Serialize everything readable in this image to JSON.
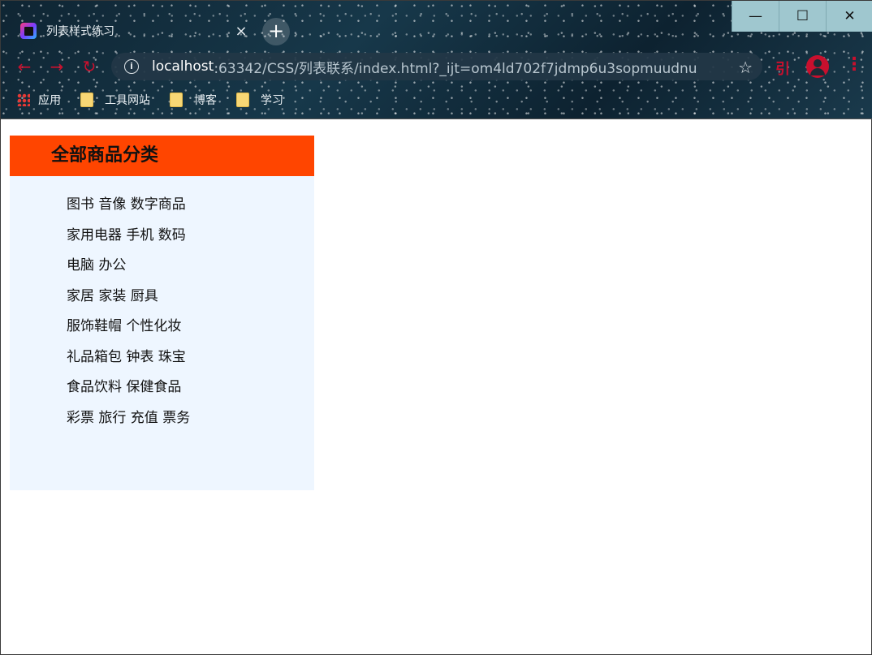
{
  "browser": {
    "tab_title": "列表样式练习",
    "tab_close": "×",
    "new_tab": "+",
    "window": {
      "minimize": "—",
      "maximize": "☐",
      "close": "✕"
    },
    "nav": {
      "back": "←",
      "forward": "→",
      "reload": "↻"
    },
    "address": {
      "host": "localhost",
      "rest": ":63342/CSS/列表联系/index.html?_ijt=om4ld702f7jdmp6u3sopmuudnu"
    },
    "star": "☆",
    "ext_label": "引",
    "menu": "⋮",
    "bookmarks": [
      {
        "label": "应用",
        "icon": "apps-grid-icon"
      },
      {
        "label": "工具网站",
        "icon": "folder-icon"
      },
      {
        "label": "博客",
        "icon": "folder-icon"
      },
      {
        "label": "学习",
        "icon": "folder-icon"
      }
    ],
    "accent_color": "#c8102e"
  },
  "page": {
    "header_title": "全部商品分类",
    "header_color": "#ff4500",
    "box_color": "#eef6ff",
    "categories": [
      "图书 音像 数字商品",
      "家用电器 手机 数码",
      "电脑 办公",
      "家居 家装 厨具",
      "服饰鞋帽 个性化妆",
      "礼品箱包 钟表 珠宝",
      "食品饮料 保健食品",
      "彩票 旅行 充值 票务"
    ]
  }
}
